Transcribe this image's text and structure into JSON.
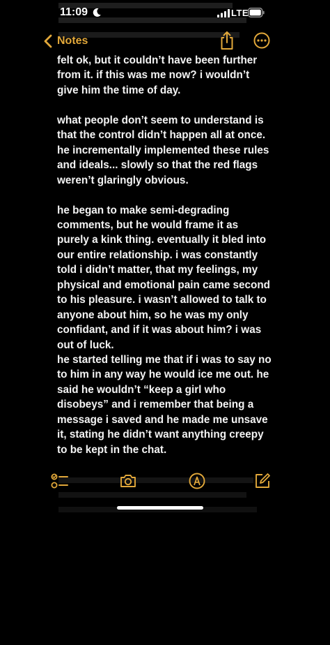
{
  "status_bar": {
    "time": "11:09",
    "network": "LTE"
  },
  "nav": {
    "back_label": "Notes"
  },
  "note": {
    "paragraphs": [
      "felt ok, but it couldn’t have been further from it. if this was me now? i wouldn’t give him the time of day.",
      "what people don’t seem to understand is that the control didn’t happen all at once. he incrementally implemented these rules and ideals... slowly so that the red flags weren’t glaringly obvious.",
      "he began to make semi-degrading comments, but he would frame it as purely a kink thing. eventually it bled into our entire relationship. i was constantly told i didn’t matter, that my feelings, my physical and emotional pain came second to his pleasure. i wasn’t allowed to talk to anyone about him, so he was my only confidant, and if it was about him? i was out of luck.",
      "he started telling me that if i was to say no to him in any way he would ice me out. he said he wouldn’t “keep a girl who disobeys” and i remember that being a message i saved and he made me unsave it, stating he didn’t want anything creepy to be kept in the chat."
    ]
  },
  "colors": {
    "accent": "#e2a83a",
    "background": "#000000",
    "text": "#f3f3f3"
  },
  "icons": {
    "back": "chevron-left-icon",
    "share": "share-icon",
    "more": "more-icon",
    "checklist": "checklist-icon",
    "camera": "camera-icon",
    "markup": "markup-icon",
    "compose": "compose-icon"
  }
}
